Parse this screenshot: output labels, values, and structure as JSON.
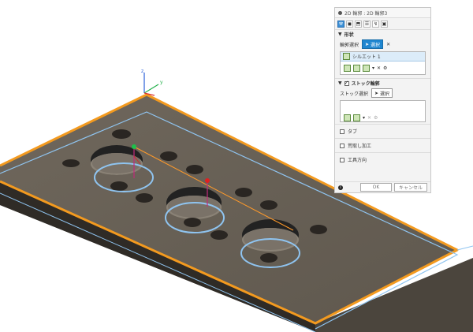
{
  "panel": {
    "title": "2D 輪郭 : 2D 輪郭3",
    "shape_section": "形状",
    "contour_select_label": "輪郭選択",
    "select_button": "選択",
    "silhouette_item": "シルエット 1",
    "stock_contour_label": "ストック輪郭",
    "stock_select_label": "ストック選択",
    "tab_label": "タブ",
    "roughing_label": "荒取し加工",
    "tool_direction_label": "工具方向",
    "ok": "OK",
    "cancel": "キャンセル"
  },
  "axes": {
    "x": "x",
    "y": "y",
    "z": "z"
  },
  "colors": {
    "plate_top": "#6b6358",
    "plate_edge": "#f39a1f",
    "contour_blue": "#8fc4f0",
    "path_orange": "#ff9a2a"
  },
  "icons": {
    "panel_dot": "dot-icon",
    "collapse": "triangle-down-icon",
    "cursor": "cursor-icon",
    "close": "close-icon",
    "gear": "gear-icon",
    "info": "info-icon"
  }
}
